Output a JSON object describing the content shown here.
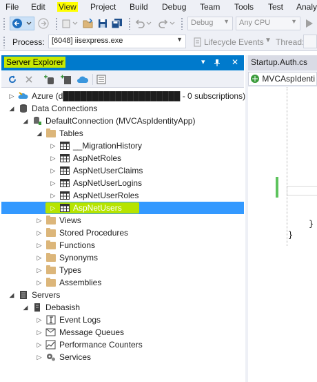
{
  "menu": {
    "items": [
      "File",
      "Edit",
      "View",
      "Project",
      "Build",
      "Debug",
      "Team",
      "Tools",
      "Test",
      "Analy"
    ]
  },
  "toolbar": {
    "config": "Debug",
    "platform": "Any CPU"
  },
  "process_bar": {
    "label": "Process:",
    "process": "[6048] iisexpress.exe",
    "lifecycle": "Lifecycle Events",
    "thread": "Thread:"
  },
  "server_explorer": {
    "title": "Server Explorer",
    "title_buttons": [
      "▾",
      "ᵖ",
      "✕"
    ],
    "tree": [
      {
        "label": "Azure (d████████████████████ - 0 subscriptions)",
        "icon": "azure-icon",
        "expander": "collapsed"
      },
      {
        "label": "Data Connections",
        "icon": "database-icon",
        "expander": "expanded"
      },
      {
        "label": "DefaultConnection (MVCAspIdentityApp)",
        "icon": "connection-icon",
        "expander": "expanded"
      },
      {
        "label": "Tables",
        "icon": "folder-icon",
        "expander": "expanded"
      },
      {
        "label": "__MigrationHistory",
        "icon": "table-icon",
        "expander": "collapsed"
      },
      {
        "label": "AspNetRoles",
        "icon": "table-icon",
        "expander": "collapsed"
      },
      {
        "label": "AspNetUserClaims",
        "icon": "table-icon",
        "expander": "collapsed"
      },
      {
        "label": "AspNetUserLogins",
        "icon": "table-icon",
        "expander": "collapsed"
      },
      {
        "label": "AspNetUserRoles",
        "icon": "table-icon",
        "expander": "collapsed"
      },
      {
        "label": "AspNetUsers",
        "icon": "table-icon",
        "expander": "collapsed",
        "selected": true
      },
      {
        "label": "Views",
        "icon": "folder-icon",
        "expander": "collapsed"
      },
      {
        "label": "Stored Procedures",
        "icon": "folder-icon",
        "expander": "collapsed"
      },
      {
        "label": "Functions",
        "icon": "folder-icon",
        "expander": "collapsed"
      },
      {
        "label": "Synonyms",
        "icon": "folder-icon",
        "expander": "collapsed"
      },
      {
        "label": "Types",
        "icon": "folder-icon",
        "expander": "collapsed"
      },
      {
        "label": "Assemblies",
        "icon": "folder-icon",
        "expander": "collapsed"
      },
      {
        "label": "Servers",
        "icon": "servers-icon",
        "expander": "expanded"
      },
      {
        "label": "Debasish",
        "icon": "server-icon",
        "expander": "expanded"
      },
      {
        "label": "Event Logs",
        "icon": "event-log-icon",
        "expander": "collapsed"
      },
      {
        "label": "Message Queues",
        "icon": "message-queue-icon",
        "expander": "collapsed"
      },
      {
        "label": "Performance Counters",
        "icon": "perf-counter-icon",
        "expander": "collapsed"
      },
      {
        "label": "Services",
        "icon": "services-icon",
        "expander": "collapsed"
      }
    ]
  },
  "editor": {
    "tab": "Startup.Auth.cs",
    "nav": "MVCAspIdenti",
    "code_lines": [
      "}",
      "}"
    ]
  },
  "colors": {
    "accent": "#007acc",
    "selection": "#3399ff",
    "highlight_yellow": "#ffff00",
    "highlight_green": "#b6e400"
  }
}
